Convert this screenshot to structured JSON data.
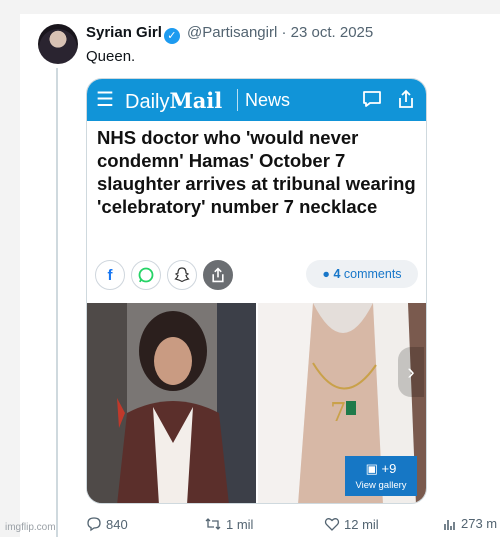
{
  "tweet": {
    "display_name": "Syrian Girl",
    "handle": "@Partisangirl",
    "separator": "·",
    "date": "23 oct. 2025",
    "text": "Queen."
  },
  "card": {
    "brand_daily": "Daily",
    "brand_mail": "Mail",
    "section": "News",
    "headline": "NHS doctor who 'would never condemn' Hamas' October 7 slaughter arrives at tribunal wearing 'celebratory' number 7 necklace",
    "comments_count": "4",
    "comments_label": "comments",
    "gallery_count": "+9",
    "gallery_label": "View gallery",
    "bar_color": "#1194d8"
  },
  "actions": {
    "replies": "840",
    "reposts": "1 mil",
    "likes": "12 mil",
    "views": "273 m"
  },
  "watermark": "imgflip.com",
  "icons": [
    "avatar",
    "verified-badge",
    "hamburger-icon",
    "chat-icon",
    "share-icon",
    "facebook-icon",
    "whatsapp-icon",
    "snapchat-icon",
    "share-icon",
    "comment-bubble-icon",
    "gallery-icon",
    "reply-icon",
    "repost-icon",
    "like-icon",
    "views-icon"
  ]
}
